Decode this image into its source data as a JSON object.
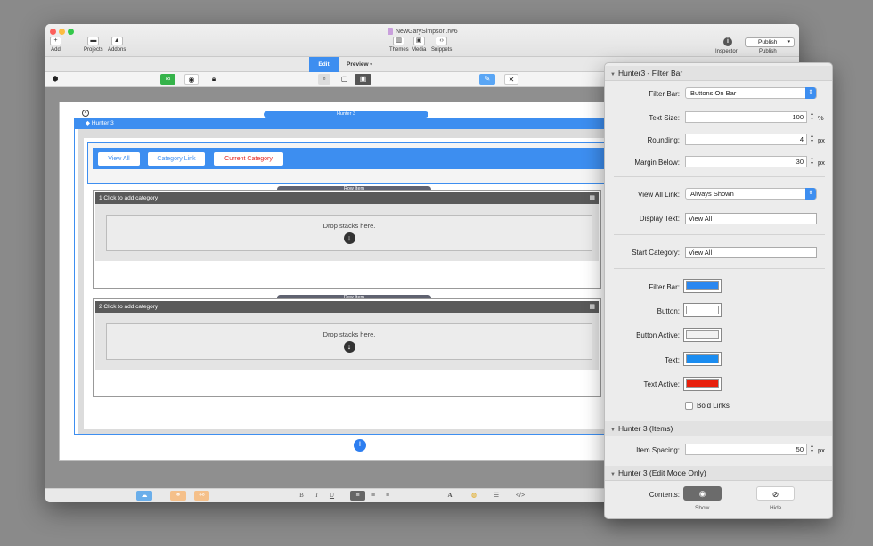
{
  "window": {
    "doc_title": "NewGarySimpson.rw6",
    "toolbar": {
      "add_label": "Add",
      "projects_label": "Projects",
      "addons_label": "Addons",
      "themes_label": "Themes",
      "media_label": "Media",
      "snippets_label": "Snippets",
      "inspector_label": "Inspector",
      "publish_button": "Publish",
      "publish_label": "Publish"
    },
    "tabs": {
      "edit": "Edit",
      "preview": "Preview"
    }
  },
  "canvas": {
    "hunter_pill": "Hunter 3",
    "hunter_bar": "Hunter 3",
    "filter_buttons": [
      "View All",
      "Category Link",
      "Current Category"
    ],
    "row_pill": "Row Item",
    "rows": [
      {
        "header": "1 Click to add category",
        "drop_text": "Drop stacks here."
      },
      {
        "header": "2 Click to add category",
        "drop_text": "Drop stacks here."
      }
    ],
    "add_symbol": "+"
  },
  "inspector": {
    "section1": "Hunter3 - Filter Bar",
    "filter_bar_label": "Filter Bar:",
    "filter_bar_value": "Buttons On Bar",
    "text_size_label": "Text Size:",
    "text_size_value": "100",
    "text_size_unit": "%",
    "rounding_label": "Rounding:",
    "rounding_value": "4",
    "rounding_unit": "px",
    "margin_label": "Margin Below:",
    "margin_value": "30",
    "margin_unit": "px",
    "view_all_link_label": "View All Link:",
    "view_all_link_value": "Always Shown",
    "display_text_label": "Display Text:",
    "display_text_value": "View All",
    "start_category_label": "Start Category:",
    "start_category_value": "View All",
    "color_filter_bar_label": "Filter Bar:",
    "color_button_label": "Button:",
    "color_button_active_label": "Button Active:",
    "color_text_label": "Text:",
    "color_text_active_label": "Text Active:",
    "colors": {
      "filter_bar": "#2a87f0",
      "button": "#ffffff",
      "button_active": "#f2f2f2",
      "text": "#1a8cf0",
      "text_active": "#e8200c"
    },
    "bold_links_label": "Bold Links",
    "section2": "Hunter 3 (Items)",
    "item_spacing_label": "Item Spacing:",
    "item_spacing_value": "50",
    "item_spacing_unit": "px",
    "section3": "Hunter 3 (Edit Mode Only)",
    "contents_label": "Contents:",
    "show_label": "Show",
    "hide_label": "Hide"
  },
  "bottombar": {
    "bold": "B",
    "italic": "I",
    "underline": "U",
    "font": "A",
    "code": "</>"
  }
}
